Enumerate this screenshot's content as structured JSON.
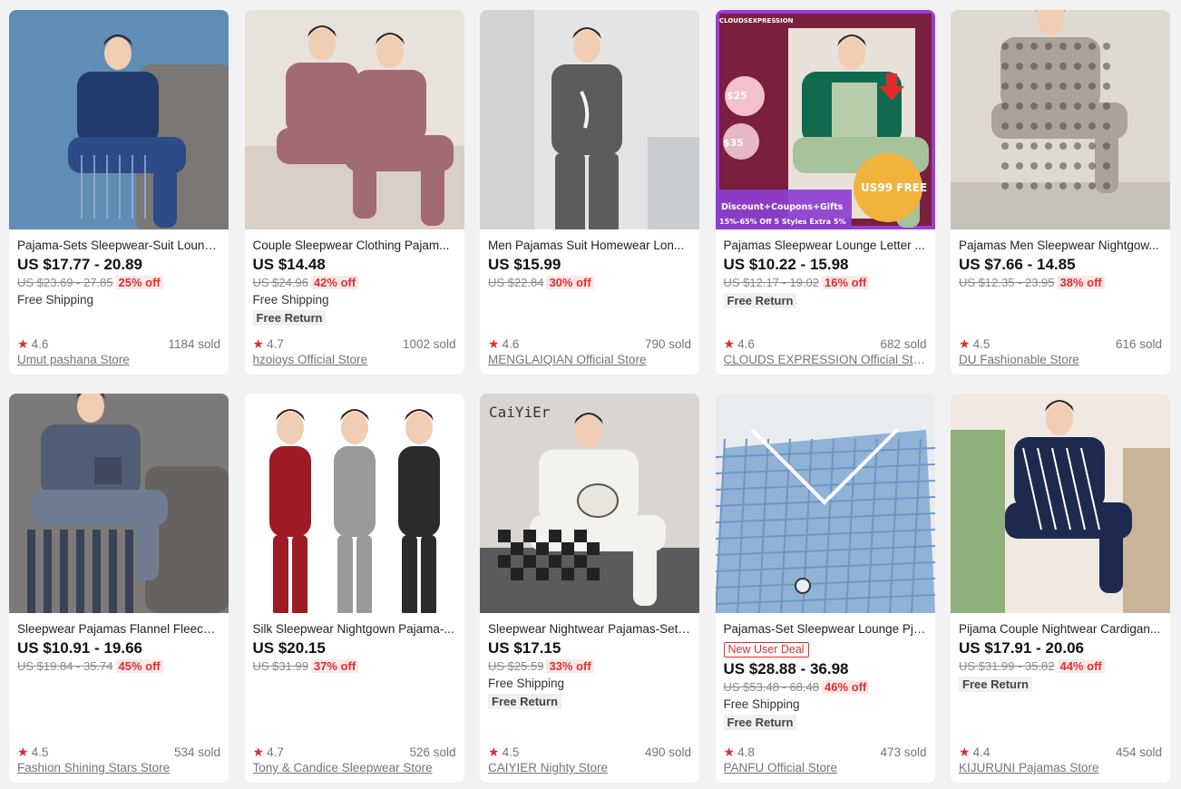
{
  "products": [
    {
      "title": "Pajama-Sets Sleepwear-Suit Loung...",
      "price": "US $17.77 - 20.89",
      "original_price": "US $23.69 - 27.85",
      "discount": "25% off",
      "free_shipping": "Free Shipping",
      "free_return": "",
      "new_user_deal": "",
      "rating": "4.6",
      "sold": "1184 sold",
      "store": "Umut pashana Store",
      "image_colors": {
        "bg": "#5f8db3",
        "main": "#223a6b",
        "accent": "#eae3d8"
      }
    },
    {
      "title": "Couple Sleepwear Clothing Pajam...",
      "price": "US $14.48",
      "original_price": "US $24.96",
      "discount": "42% off",
      "free_shipping": "Free Shipping",
      "free_return": "Free Return",
      "new_user_deal": "",
      "rating": "4.7",
      "sold": "1002 sold",
      "store": "hzoioys Official Store",
      "image_colors": {
        "bg": "#e8e2dc",
        "main": "#a26a74",
        "accent": "#c7a9a1"
      }
    },
    {
      "title": "Men Pajamas Suit Homewear Lon...",
      "price": "US $15.99",
      "original_price": "US $22.84",
      "discount": "30% off",
      "free_shipping": "",
      "free_return": "",
      "new_user_deal": "",
      "rating": "4.6",
      "sold": "790 sold",
      "store": "MENGLAIQIAN Official Store",
      "image_colors": {
        "bg": "#e4e4e4",
        "main": "#5c5c5c",
        "accent": "#f6f6f6"
      }
    },
    {
      "title": "Pajamas Sleepwear Lounge Letter ...",
      "price": "US $10.22 - 15.98",
      "original_price": "US $12.17 - 19.02",
      "discount": "16% off",
      "free_shipping": "",
      "free_return": "Free Return",
      "new_user_deal": "",
      "rating": "4.6",
      "sold": "682 sold",
      "store": "CLOUDS EXPRESSION Official Store",
      "image_colors": {
        "bg": "#7a1f3d",
        "main": "#0f6a4f",
        "accent": "#9a3fd6"
      },
      "image_text": {
        "brand": "CLOUDSEXPRESSION",
        "promo": "Discount+Coupons+Gifts",
        "promo2": "15%-65% Off 5 Styles Extra 5%",
        "free": "US99 FREE",
        "tag1": "$25",
        "tag2": "$35"
      }
    },
    {
      "title": "Pajamas Men Sleepwear Nightgow...",
      "price": "US $7.66 - 14.85",
      "original_price": "US $12.35 - 23.95",
      "discount": "38% off",
      "free_shipping": "",
      "free_return": "",
      "new_user_deal": "",
      "rating": "4.5",
      "sold": "616 sold",
      "store": "DU Fashionable Store",
      "image_colors": {
        "bg": "#ded9d2",
        "main": "#a9a39a",
        "accent": "#4a4540"
      }
    },
    {
      "title": "Sleepwear Pajamas Flannel Fleece ...",
      "price": "US $10.91 - 19.66",
      "original_price": "US $19.84 - 35.74",
      "discount": "45% off",
      "free_shipping": "",
      "free_return": "",
      "new_user_deal": "",
      "rating": "4.5",
      "sold": "534 sold",
      "store": "Fashion Shining Stars Store",
      "image_colors": {
        "bg": "#7c7a78",
        "main": "#515d75",
        "accent": "#6f7c92"
      }
    },
    {
      "title": "Silk Sleepwear Nightgown Pajama-...",
      "price": "US $20.15",
      "original_price": "US $31.99",
      "discount": "37% off",
      "free_shipping": "",
      "free_return": "",
      "new_user_deal": "",
      "rating": "4.7",
      "sold": "526 sold",
      "store": "Tony & Candice Sleepwear Store",
      "image_colors": {
        "bg": "#ffffff",
        "main": "#9e1a25",
        "accent": "#9a9a9a",
        "third": "#2b2b2b"
      }
    },
    {
      "title": "Sleepwear Nightwear Pajamas-Set ...",
      "price": "US $17.15",
      "original_price": "US $25.59",
      "discount": "33% off",
      "free_shipping": "Free Shipping",
      "free_return": "Free Return",
      "new_user_deal": "",
      "rating": "4.5",
      "sold": "490 sold",
      "store": "CAIYIER Nighty Store",
      "image_colors": {
        "bg": "#d9d6d1",
        "main": "#f4f2ee",
        "accent": "#222222"
      },
      "image_text": {
        "brand": "CaiYiEr"
      }
    },
    {
      "title": "Pajamas-Set Sleepwear Lounge Pjs...",
      "price": "US $28.88 - 36.98",
      "original_price": "US $53.48 - 68.48",
      "discount": "46% off",
      "free_shipping": "Free Shipping",
      "free_return": "Free Return",
      "new_user_deal": "New User Deal",
      "rating": "4.8",
      "sold": "473 sold",
      "store": "PANFU Official Store",
      "image_colors": {
        "bg": "#e9ecef",
        "main": "#8fb2d6",
        "accent": "#ffffff"
      }
    },
    {
      "title": "Pijama Couple Nightwear Cardigan...",
      "price": "US $17.91 - 20.06",
      "original_price": "US $31.99 - 35.82",
      "discount": "44% off",
      "free_shipping": "",
      "free_return": "Free Return",
      "new_user_deal": "",
      "rating": "4.4",
      "sold": "454 sold",
      "store": "KIJURUNI Pajamas Store",
      "image_colors": {
        "bg": "#efe9e2",
        "main": "#1d2a4e",
        "accent": "#ffffff"
      }
    }
  ]
}
